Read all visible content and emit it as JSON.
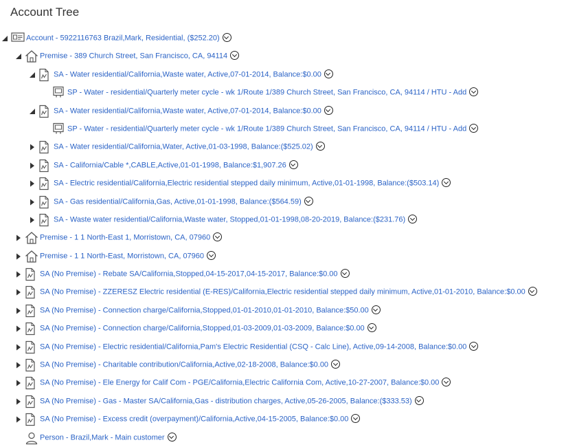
{
  "page": {
    "title": "Account Tree"
  },
  "tree": [
    {
      "level": 0,
      "toggle": "expanded",
      "icon": "account-card-icon",
      "label": "Account - 5922116763 Brazil,Mark, Residential, ($252.20)"
    },
    {
      "level": 1,
      "toggle": "expanded",
      "icon": "house-icon",
      "label": "Premise - 389 Church Street, San Francisco, CA, 94114"
    },
    {
      "level": 2,
      "toggle": "expanded",
      "icon": "document-icon",
      "label": "SA - Water residential/California,Waste water, Active,07-01-2014, Balance:$0.00"
    },
    {
      "level": 3,
      "toggle": "none",
      "icon": "meter-icon",
      "label": "SP - Water - residential/Quarterly meter cycle - wk 1/Route 1/389 Church Street, San Francisco, CA, 94114 / HTU - Add"
    },
    {
      "level": 2,
      "toggle": "expanded",
      "icon": "document-icon",
      "label": "SA - Water residential/California,Waste water, Active,07-01-2014, Balance:$0.00"
    },
    {
      "level": 3,
      "toggle": "none",
      "icon": "meter-icon",
      "label": "SP - Water - residential/Quarterly meter cycle - wk 1/Route 1/389 Church Street, San Francisco, CA, 94114 / HTU - Add"
    },
    {
      "level": 2,
      "toggle": "collapsed",
      "icon": "document-icon",
      "label": "SA - Water residential/California,Water, Active,01-03-1998, Balance:($525.02)"
    },
    {
      "level": 2,
      "toggle": "collapsed",
      "icon": "document-icon",
      "label": "SA - California/Cable *,CABLE,Active,01-01-1998, Balance:$1,907.26"
    },
    {
      "level": 2,
      "toggle": "collapsed",
      "icon": "document-icon",
      "label": "SA - Electric residential/California,Electric residential stepped daily minimum, Active,01-01-1998, Balance:($503.14)"
    },
    {
      "level": 2,
      "toggle": "collapsed",
      "icon": "document-icon",
      "label": "SA - Gas residential/California,Gas, Active,01-01-1998, Balance:($564.59)"
    },
    {
      "level": 2,
      "toggle": "collapsed",
      "icon": "document-icon",
      "label": "SA - Waste water residential/California,Waste water, Stopped,01-01-1998,08-20-2019, Balance:($231.76)"
    },
    {
      "level": 1,
      "toggle": "collapsed",
      "icon": "house-icon",
      "label": "Premise - 1 1 North-East 1, Morristown, CA, 07960"
    },
    {
      "level": 1,
      "toggle": "collapsed",
      "icon": "house-icon",
      "label": "Premise - 1 1 North-East, Morristown, CA, 07960"
    },
    {
      "level": 1,
      "toggle": "collapsed",
      "icon": "document-icon",
      "label": "SA (No Premise) - Rebate SA/California,Stopped,04-15-2017,04-15-2017, Balance:$0.00"
    },
    {
      "level": 1,
      "toggle": "collapsed",
      "icon": "document-icon",
      "label": "SA (No Premise) - ZZERESZ Electric residential (E-RES)/California,Electric residential stepped daily minimum, Active,01-01-2010, Balance:$0.00"
    },
    {
      "level": 1,
      "toggle": "collapsed",
      "icon": "document-icon",
      "label": "SA (No Premise) - Connection charge/California,Stopped,01-01-2010,01-01-2010, Balance:$50.00"
    },
    {
      "level": 1,
      "toggle": "collapsed",
      "icon": "document-icon",
      "label": "SA (No Premise) - Connection charge/California,Stopped,01-03-2009,01-03-2009, Balance:$0.00"
    },
    {
      "level": 1,
      "toggle": "collapsed",
      "icon": "document-icon",
      "label": "SA (No Premise) - Electric residential/California,Pam's Electric Residential (CSQ - Calc Line), Active,09-14-2008, Balance:$0.00"
    },
    {
      "level": 1,
      "toggle": "collapsed",
      "icon": "document-icon",
      "label": "SA (No Premise) - Charitable contribution/California,Active,02-18-2008, Balance:$0.00"
    },
    {
      "level": 1,
      "toggle": "collapsed",
      "icon": "document-icon",
      "label": "SA (No Premise) - Ele Energy for Calif Com - PGE/California,Electric California Com, Active,10-27-2007, Balance:$0.00"
    },
    {
      "level": 1,
      "toggle": "collapsed",
      "icon": "document-icon",
      "label": "SA (No Premise) - Gas - Master SA/California,Gas - distribution charges, Active,05-26-2005, Balance:($333.53)"
    },
    {
      "level": 1,
      "toggle": "collapsed",
      "icon": "document-icon",
      "label": "SA (No Premise) - Excess credit (overpayment)/California,Active,04-15-2005, Balance:$0.00"
    },
    {
      "level": 1,
      "toggle": "none",
      "icon": "person-icon",
      "label": "Person - Brazil,Mark - Main customer"
    }
  ],
  "colors": {
    "link": "#2b63c6",
    "text": "#333333",
    "icon": "#555555"
  }
}
